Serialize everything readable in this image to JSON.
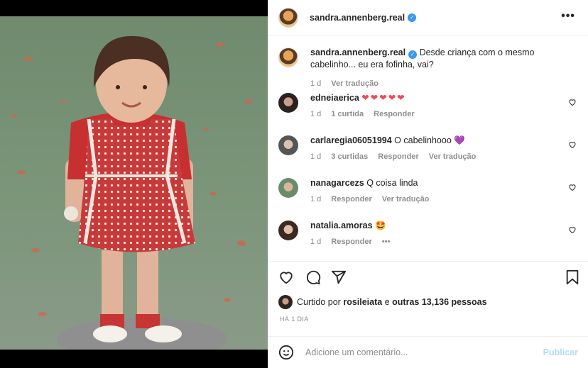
{
  "post": {
    "owner_username": "sandra.annenberg.real",
    "verified_mark": "✓",
    "more_label": "•••"
  },
  "caption": {
    "username": "sandra.annenberg.real",
    "text": "Desde criança com o mesmo cabelinho... eu era fofinha, vai?",
    "time": "1 d",
    "translate": "Ver tradução"
  },
  "comments": [
    {
      "username": "edneiaerica",
      "text": "❤❤❤❤❤",
      "time": "1 d",
      "likes": "1 curtida",
      "reply": "Responder",
      "translate": ""
    },
    {
      "username": "carlaregia06051994",
      "text": "O cabelinhooo 💜",
      "time": "1 d",
      "likes": "3 curtidas",
      "reply": "Responder",
      "translate": "Ver tradução"
    },
    {
      "username": "nanagarcezs",
      "text": "Q coisa linda",
      "time": "1 d",
      "likes": "",
      "reply": "Responder",
      "translate": "Ver tradução"
    },
    {
      "username": "natalia.amoras",
      "text": "🤩",
      "time": "1 d",
      "likes": "",
      "reply": "Responder",
      "translate": "•••"
    }
  ],
  "likes": {
    "prefix": "Curtido por",
    "user": "rosileiata",
    "middle": "e",
    "count": "outras 13,136 pessoas"
  },
  "date_label": "HÁ 1 DIA",
  "add_comment": {
    "placeholder": "Adicione um comentário...",
    "publish": "Publicar"
  },
  "colors": {
    "verified": "#3897f0",
    "heart_red": "#ed4956",
    "publish_disabled": "#b3dbff"
  },
  "icons": [
    "heart-icon",
    "comment-icon",
    "share-icon",
    "bookmark-icon",
    "emoji-icon",
    "more-icon"
  ]
}
